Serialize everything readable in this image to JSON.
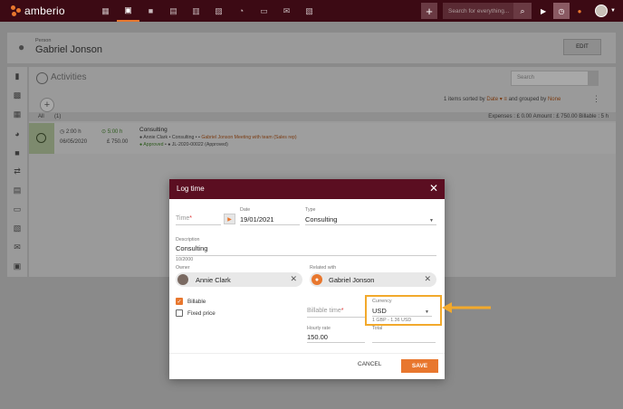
{
  "brand": {
    "name": "amberio"
  },
  "topbar": {
    "nav_icons": [
      "dashboard-icon",
      "contacts-icon",
      "briefcase-icon",
      "document-icon",
      "bank-icon",
      "calendar-icon",
      "history-icon",
      "folder-icon",
      "mail-icon",
      "chart-icon"
    ],
    "search_placeholder": "Search for everything...",
    "add_label": "+"
  },
  "person": {
    "type_label": "Person",
    "name": "Gabriel Jonson",
    "edit_label": "EDIT"
  },
  "activities": {
    "title": "Activities",
    "search_placeholder": "Search",
    "sort_prefix": "1 items sorted by",
    "sort_field": "Date",
    "group_prefix": "and grouped by",
    "group_field": "None",
    "filter": {
      "label": "All",
      "count": "(1)"
    },
    "totals": "Expenses : £ 0.00     Amount : £ 750.00     Billable : 5 h",
    "entry": {
      "duration": "2:00 h",
      "date": "06/05/2020",
      "billable": "5:00 h",
      "amount": "£ 750.00",
      "title": "Consulting",
      "owner": "Annie Clark",
      "category": "Consulting",
      "related": "Gabriel Jonson Meeting with team (Sales rep)",
      "status": "Approved",
      "ref": "JL-2020-00022 (Approved)"
    }
  },
  "dialog": {
    "title": "Log time",
    "time_label": "Time",
    "date_label": "Date",
    "date_value": "19/01/2021",
    "type_label": "Type",
    "type_value": "Consulting",
    "description_label": "Description",
    "description_value": "Consulting",
    "char_count": "10/2000",
    "owner_label": "Owner",
    "owner_value": "Annie Clark",
    "related_label": "Related with",
    "related_value": "Gabriel Jonson",
    "billable_label": "Billable",
    "billable_checked": true,
    "fixed_price_label": "Fixed price",
    "fixed_price_checked": false,
    "billable_time_label": "Billable time",
    "currency_label": "Currency",
    "currency_value": "USD",
    "currency_rate": "1 GBP - 1.36 USD",
    "hourly_rate_label": "Hourly rate",
    "hourly_rate_value": "150.00",
    "total_label": "Total",
    "cancel_label": "CANCEL",
    "save_label": "SAVE"
  },
  "colors": {
    "topbar": "#3c0a14",
    "dialog_header": "#5b0e21",
    "accent": "#e8772e",
    "highlight": "#f2a92c"
  }
}
